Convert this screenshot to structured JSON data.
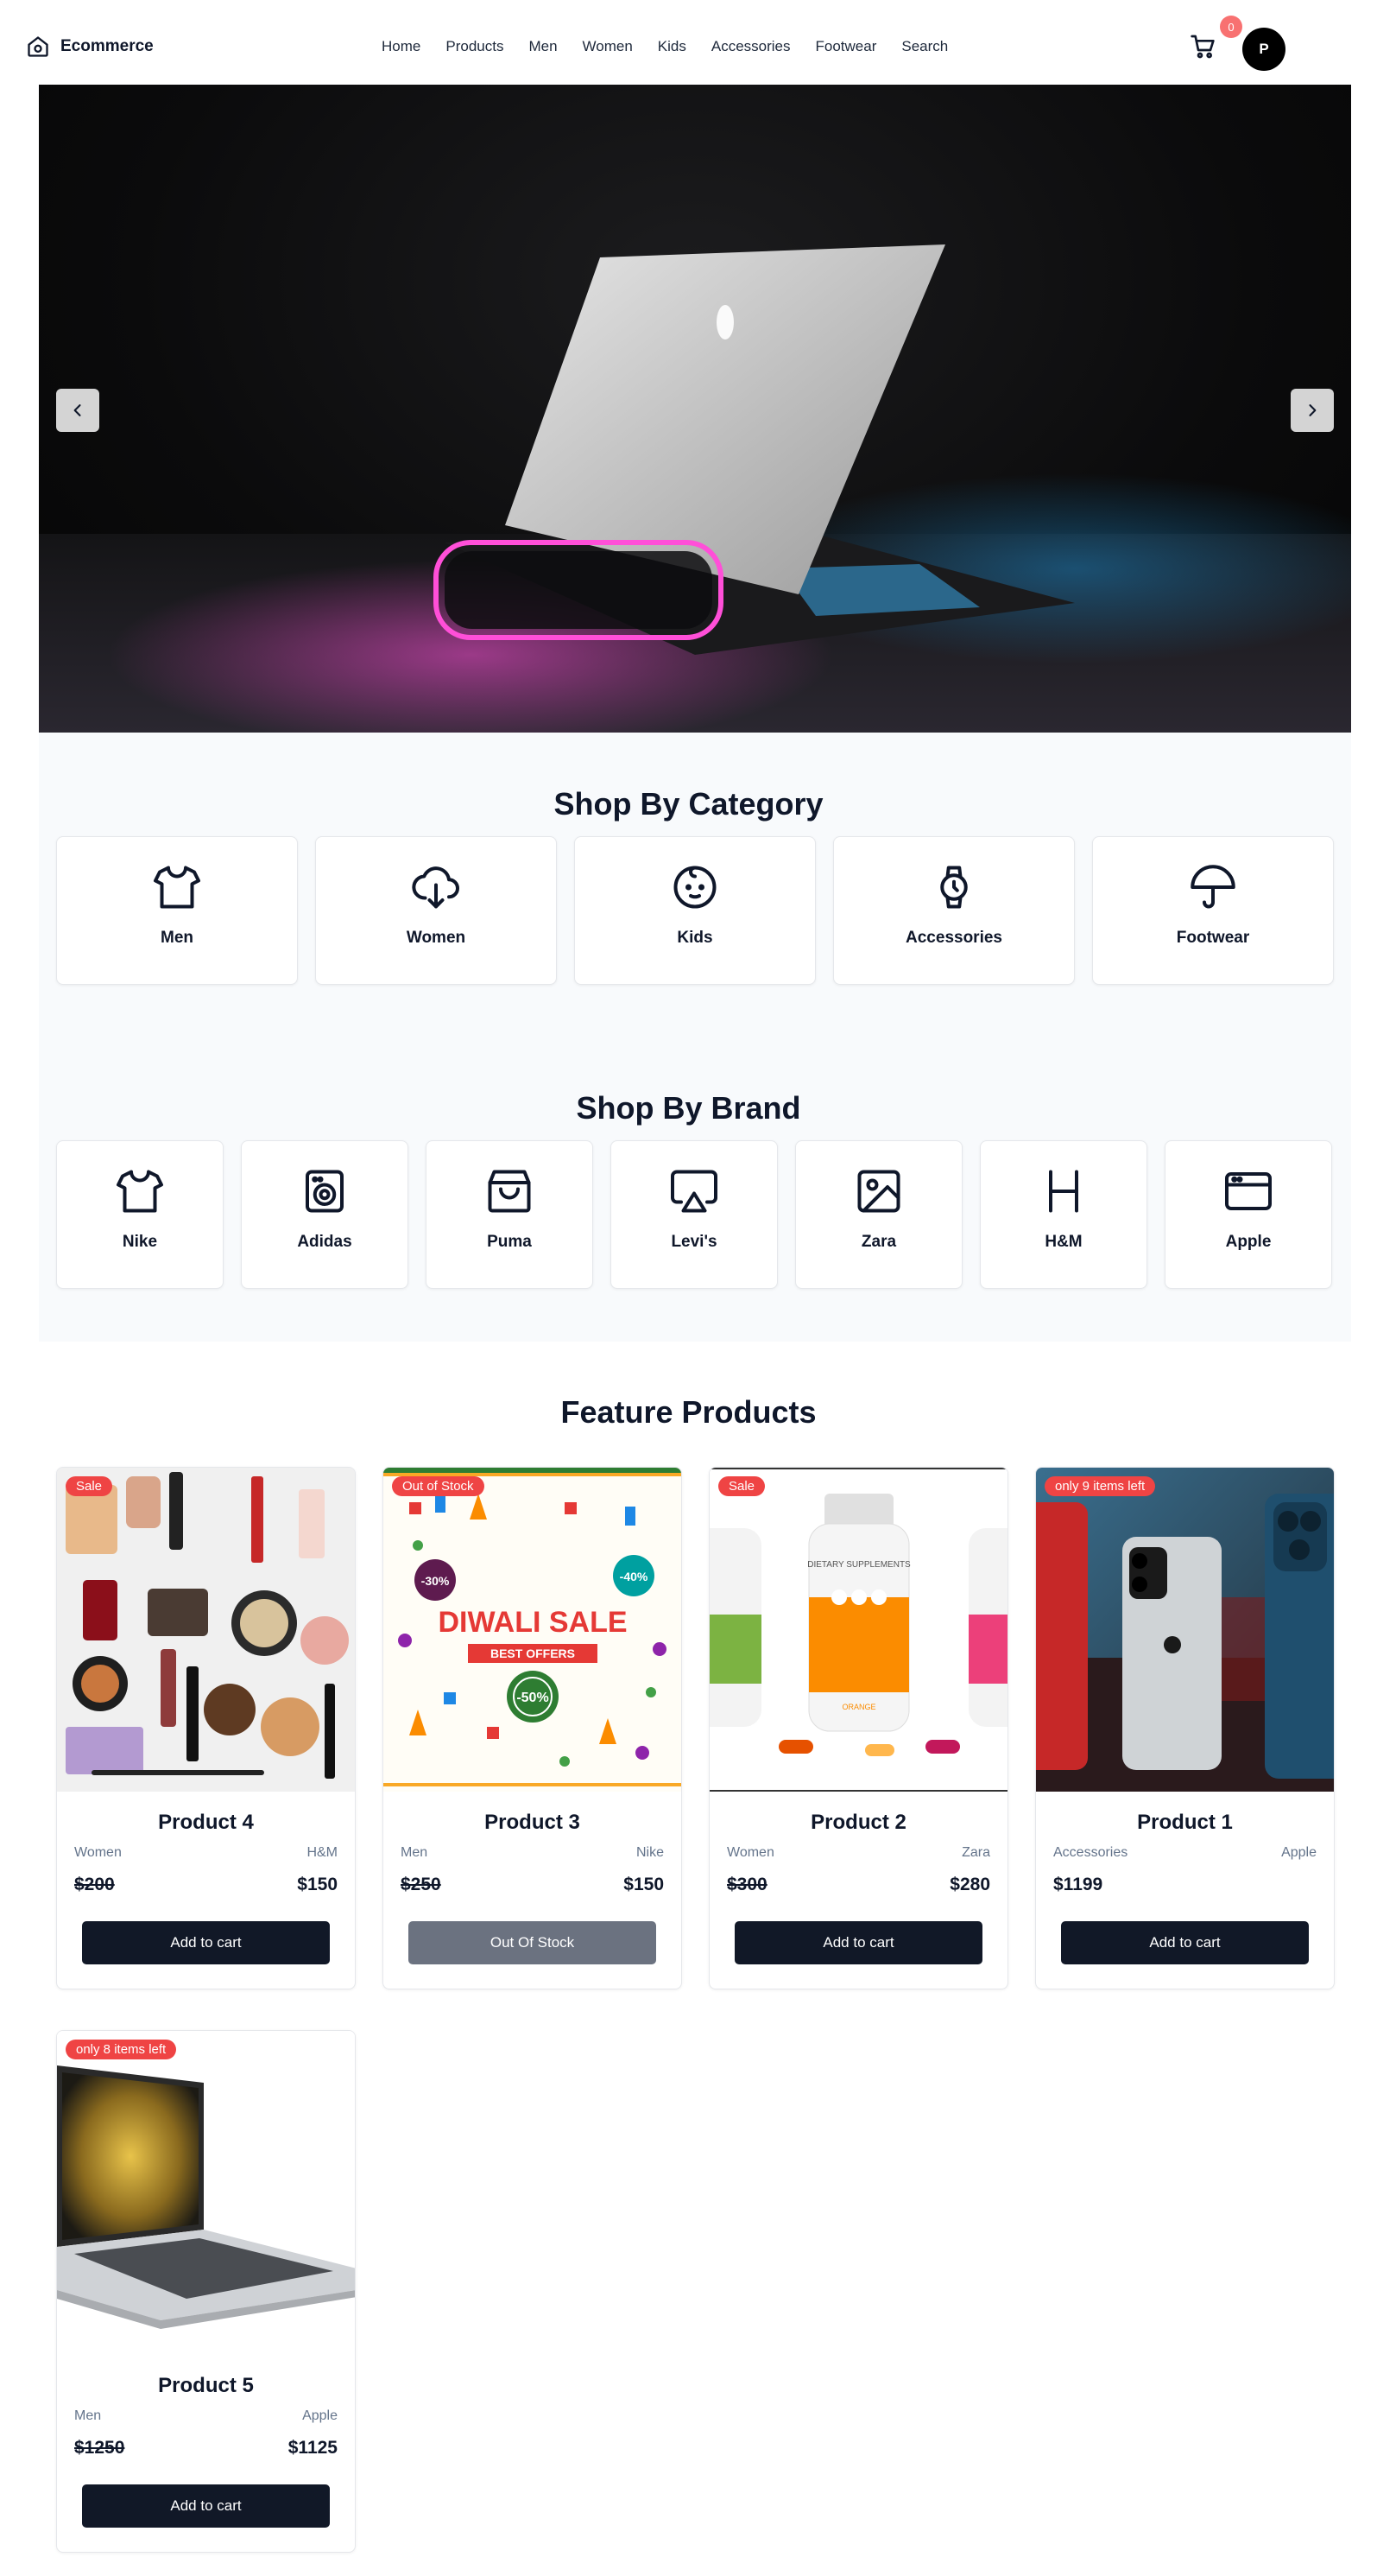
{
  "header": {
    "brand": "Ecommerce",
    "nav": [
      "Home",
      "Products",
      "Men",
      "Women",
      "Kids",
      "Accessories",
      "Footwear",
      "Search"
    ],
    "cart_count": "0",
    "avatar_initial": "P"
  },
  "categories": {
    "title": "Shop By Category",
    "items": [
      {
        "label": "Men",
        "icon": "shirt-icon"
      },
      {
        "label": "Women",
        "icon": "cloud-download-icon"
      },
      {
        "label": "Kids",
        "icon": "baby-face-icon"
      },
      {
        "label": "Accessories",
        "icon": "watch-icon"
      },
      {
        "label": "Footwear",
        "icon": "umbrella-icon"
      }
    ]
  },
  "brands": {
    "title": "Shop By Brand",
    "items": [
      {
        "label": "Nike",
        "icon": "shirt-icon"
      },
      {
        "label": "Adidas",
        "icon": "washing-machine-icon"
      },
      {
        "label": "Puma",
        "icon": "shopping-bag-icon"
      },
      {
        "label": "Levi's",
        "icon": "airplay-icon"
      },
      {
        "label": "Zara",
        "icon": "image-icon"
      },
      {
        "label": "H&M",
        "icon": "letter-h-icon"
      },
      {
        "label": "Apple",
        "icon": "browser-window-icon"
      }
    ]
  },
  "featured": {
    "title": "Feature Products",
    "products": [
      {
        "name": "Product 4",
        "category": "Women",
        "brand": "H&M",
        "old_price": "$200",
        "price": "$150",
        "badge": "Sale",
        "button": "Add to cart",
        "out_of_stock": false
      },
      {
        "name": "Product 3",
        "category": "Men",
        "brand": "Nike",
        "old_price": "$250",
        "price": "$150",
        "badge": "Out of Stock",
        "button": "Out Of Stock",
        "out_of_stock": true
      },
      {
        "name": "Product 2",
        "category": "Women",
        "brand": "Zara",
        "old_price": "$300",
        "price": "$280",
        "badge": "Sale",
        "button": "Add to cart",
        "out_of_stock": false
      },
      {
        "name": "Product 1",
        "category": "Accessories",
        "brand": "Apple",
        "old_price": "",
        "price": "$1199",
        "badge": "only 9 items left",
        "button": "Add to cart",
        "out_of_stock": false
      },
      {
        "name": "Product 5",
        "category": "Men",
        "brand": "Apple",
        "old_price": "$1250",
        "price": "$1125",
        "badge": "only 8 items left",
        "button": "Add to cart",
        "out_of_stock": false
      }
    ]
  },
  "diwali_image": {
    "headline": "DIWALI SALE",
    "subline": "BEST OFFERS",
    "discounts": [
      "-30%",
      "-40%",
      "-50%"
    ]
  },
  "supplement_image": {
    "label": "DIETARY SUPPLEMENTS",
    "flavor": "ORANGE"
  }
}
